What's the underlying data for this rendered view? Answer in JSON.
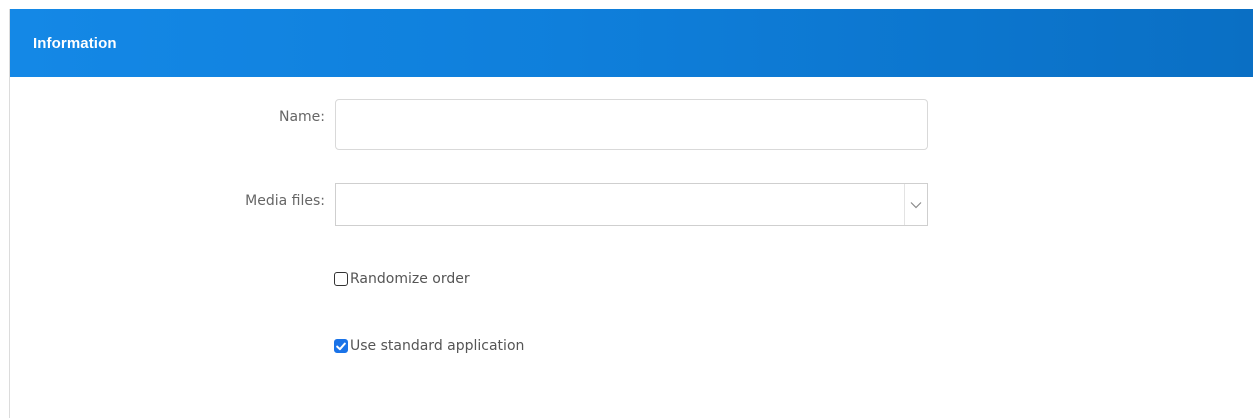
{
  "panel": {
    "title": "Information"
  },
  "form": {
    "name_label": "Name:",
    "name_value": "",
    "name_placeholder": "",
    "media_label": "Media files:",
    "media_selected": "",
    "randomize_label": "Randomize order",
    "randomize_checked": false,
    "standard_app_label": "Use standard application",
    "standard_app_checked": true
  },
  "icons": {
    "select_arrow": "chevron-down-icon",
    "check": "checkmark-icon"
  },
  "colors": {
    "header_start": "#1488e6",
    "header_end": "#0a6fc4",
    "checkbox_checked": "#1a73e8"
  }
}
